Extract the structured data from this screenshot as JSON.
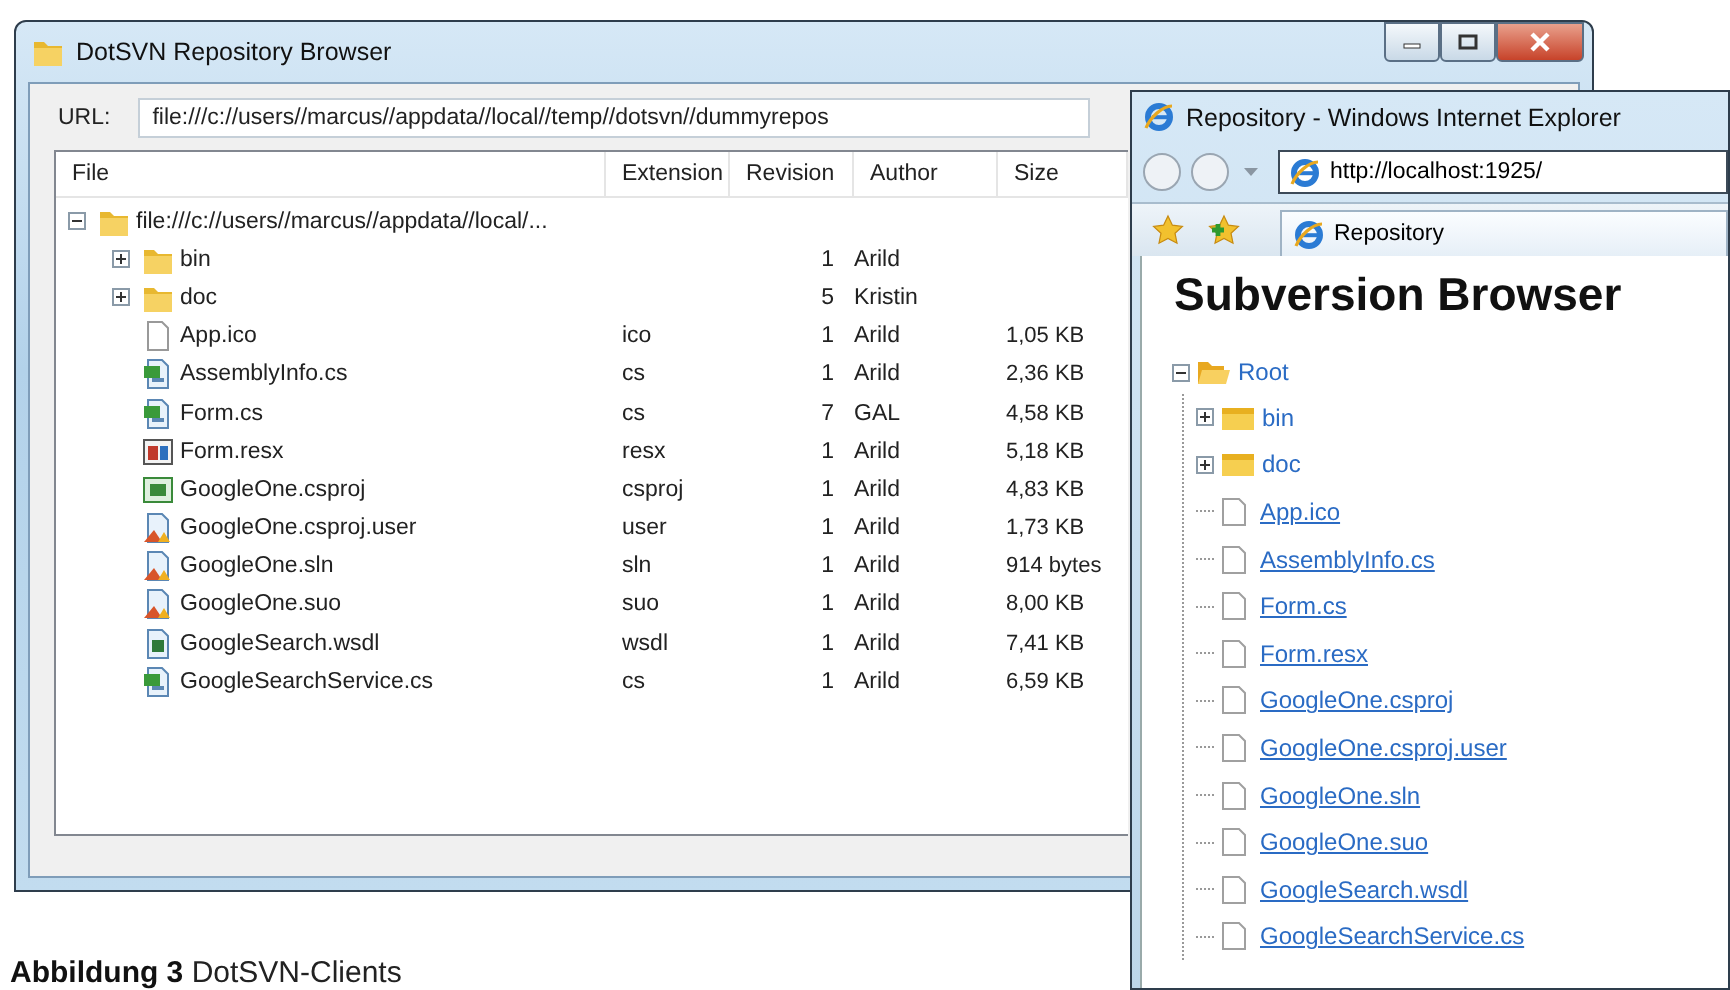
{
  "repo_browser": {
    "title": "DotSVN Repository Browser",
    "url_label": "URL:",
    "url": "file:///c://users//marcus//appdata//local//temp//dotsvn//dummyrepos",
    "columns": [
      "File",
      "Extension",
      "Revision",
      "Author",
      "Size"
    ],
    "tree": {
      "name": "file:///c://users//marcus//appdata//local/...",
      "kind": "folder",
      "expanded": true,
      "children": [
        {
          "name": "bin",
          "kind": "folder",
          "expanded": false,
          "revision": "1",
          "author": "Arild"
        },
        {
          "name": "doc",
          "kind": "folder",
          "expanded": false,
          "revision": "5",
          "author": "Kristin"
        },
        {
          "name": "App.ico",
          "kind": "document",
          "extension": "ico",
          "revision": "1",
          "author": "Arild",
          "size": "1,05 KB"
        },
        {
          "name": "AssemblyInfo.cs",
          "kind": "code",
          "extension": "cs",
          "revision": "1",
          "author": "Arild",
          "size": "2,36 KB"
        },
        {
          "name": "Form.cs",
          "kind": "code",
          "extension": "cs",
          "revision": "7",
          "author": "GAL",
          "size": "4,58 KB"
        },
        {
          "name": "Form.resx",
          "kind": "resource",
          "extension": "resx",
          "revision": "1",
          "author": "Arild",
          "size": "5,18 KB"
        },
        {
          "name": "GoogleOne.csproj",
          "kind": "project",
          "extension": "csproj",
          "revision": "1",
          "author": "Arild",
          "size": "4,83 KB"
        },
        {
          "name": "GoogleOne.csproj.user",
          "kind": "solution",
          "extension": "user",
          "revision": "1",
          "author": "Arild",
          "size": "1,73 KB"
        },
        {
          "name": "GoogleOne.sln",
          "kind": "solution",
          "extension": "sln",
          "revision": "1",
          "author": "Arild",
          "size": "914 bytes"
        },
        {
          "name": "GoogleOne.suo",
          "kind": "solution",
          "extension": "suo",
          "revision": "1",
          "author": "Arild",
          "size": "8,00 KB"
        },
        {
          "name": "GoogleSearch.wsdl",
          "kind": "service",
          "extension": "wsdl",
          "revision": "1",
          "author": "Arild",
          "size": "7,41 KB"
        },
        {
          "name": "GoogleSearchService.cs",
          "kind": "code",
          "extension": "cs",
          "revision": "1",
          "author": "Arild",
          "size": "6,59 KB"
        }
      ]
    }
  },
  "browser": {
    "title": "Repository - Windows Internet Explorer",
    "address": "http://localhost:1925/",
    "tab": "Repository",
    "heading": "Subversion Browser",
    "tree": {
      "name": "Root",
      "kind": "folder",
      "expanded": true,
      "children": [
        {
          "name": "bin",
          "kind": "folder",
          "expanded": false
        },
        {
          "name": "doc",
          "kind": "folder",
          "expanded": false
        },
        {
          "name": "App.ico",
          "kind": "file"
        },
        {
          "name": "AssemblyInfo.cs",
          "kind": "file"
        },
        {
          "name": "Form.cs",
          "kind": "file"
        },
        {
          "name": "Form.resx",
          "kind": "file"
        },
        {
          "name": "GoogleOne.csproj",
          "kind": "file"
        },
        {
          "name": "GoogleOne.csproj.user",
          "kind": "file"
        },
        {
          "name": "GoogleOne.sln",
          "kind": "file"
        },
        {
          "name": "GoogleOne.suo",
          "kind": "file"
        },
        {
          "name": "GoogleSearch.wsdl",
          "kind": "file"
        },
        {
          "name": "GoogleSearchService.cs",
          "kind": "file"
        }
      ]
    }
  },
  "caption": "**Abbildung 3** DotSVN-Clients"
}
